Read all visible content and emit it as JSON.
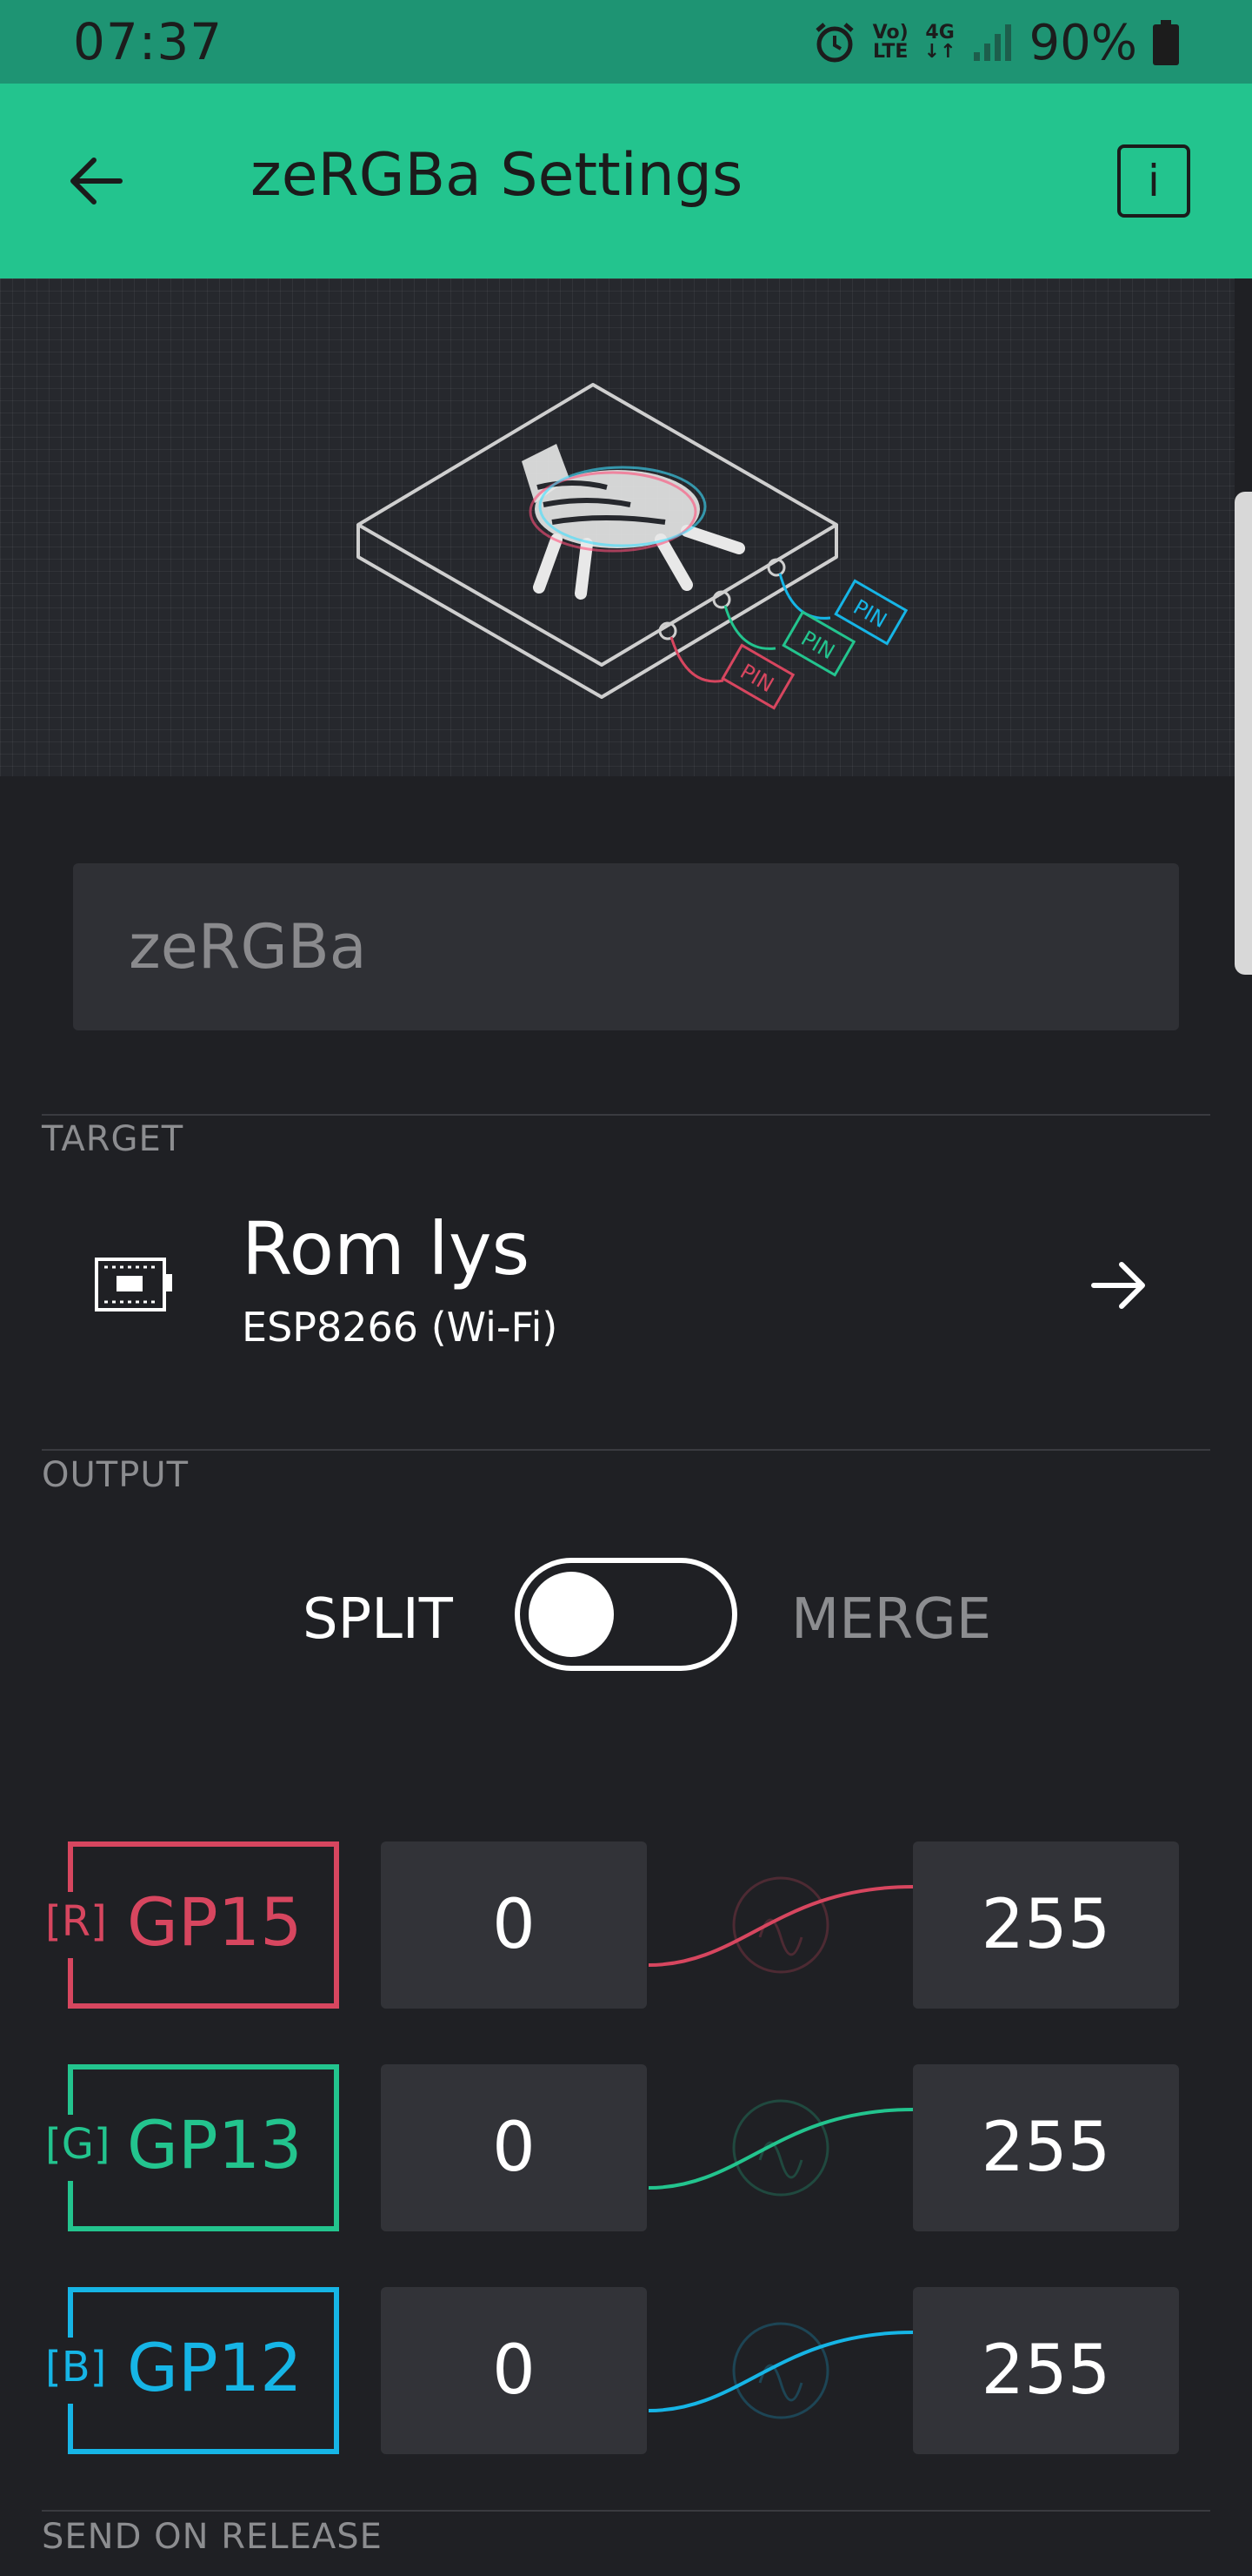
{
  "status_bar": {
    "time": "07:37",
    "volte_line1": "Vo)",
    "volte_line2": "LTE",
    "network": "4G",
    "battery": "90%"
  },
  "app_bar": {
    "title": "zeRGBa Settings",
    "back_icon": "arrow-left-icon",
    "info_label": "i"
  },
  "hero": {
    "pin_labels": [
      "PIN",
      "PIN",
      "PIN"
    ]
  },
  "name_field": {
    "placeholder": "zeRGBa"
  },
  "target": {
    "section_label": "TARGET",
    "device_name": "Rom lys",
    "device_type": "ESP8266 (Wi-Fi)",
    "icon": "device-board-icon",
    "arrow_icon": "arrow-right-icon"
  },
  "output": {
    "section_label": "OUTPUT",
    "split_label": "SPLIT",
    "merge_label": "MERGE",
    "merge_enabled": false
  },
  "pins": [
    {
      "channel": "[R]",
      "pin": "GP15",
      "min": "0",
      "max": "255",
      "color": "#d7465f"
    },
    {
      "channel": "[G]",
      "pin": "GP13",
      "min": "0",
      "max": "255",
      "color": "#23c48e"
    },
    {
      "channel": "[B]",
      "pin": "GP12",
      "min": "0",
      "max": "255",
      "color": "#16b5e6"
    }
  ],
  "send_on_release": {
    "section_label": "SEND ON RELEASE"
  },
  "colors": {
    "accent": "#23c48e",
    "status_bar": "#1e9473",
    "background": "#1f2024",
    "red": "#d7465f",
    "green": "#23c48e",
    "blue": "#16b5e6"
  }
}
